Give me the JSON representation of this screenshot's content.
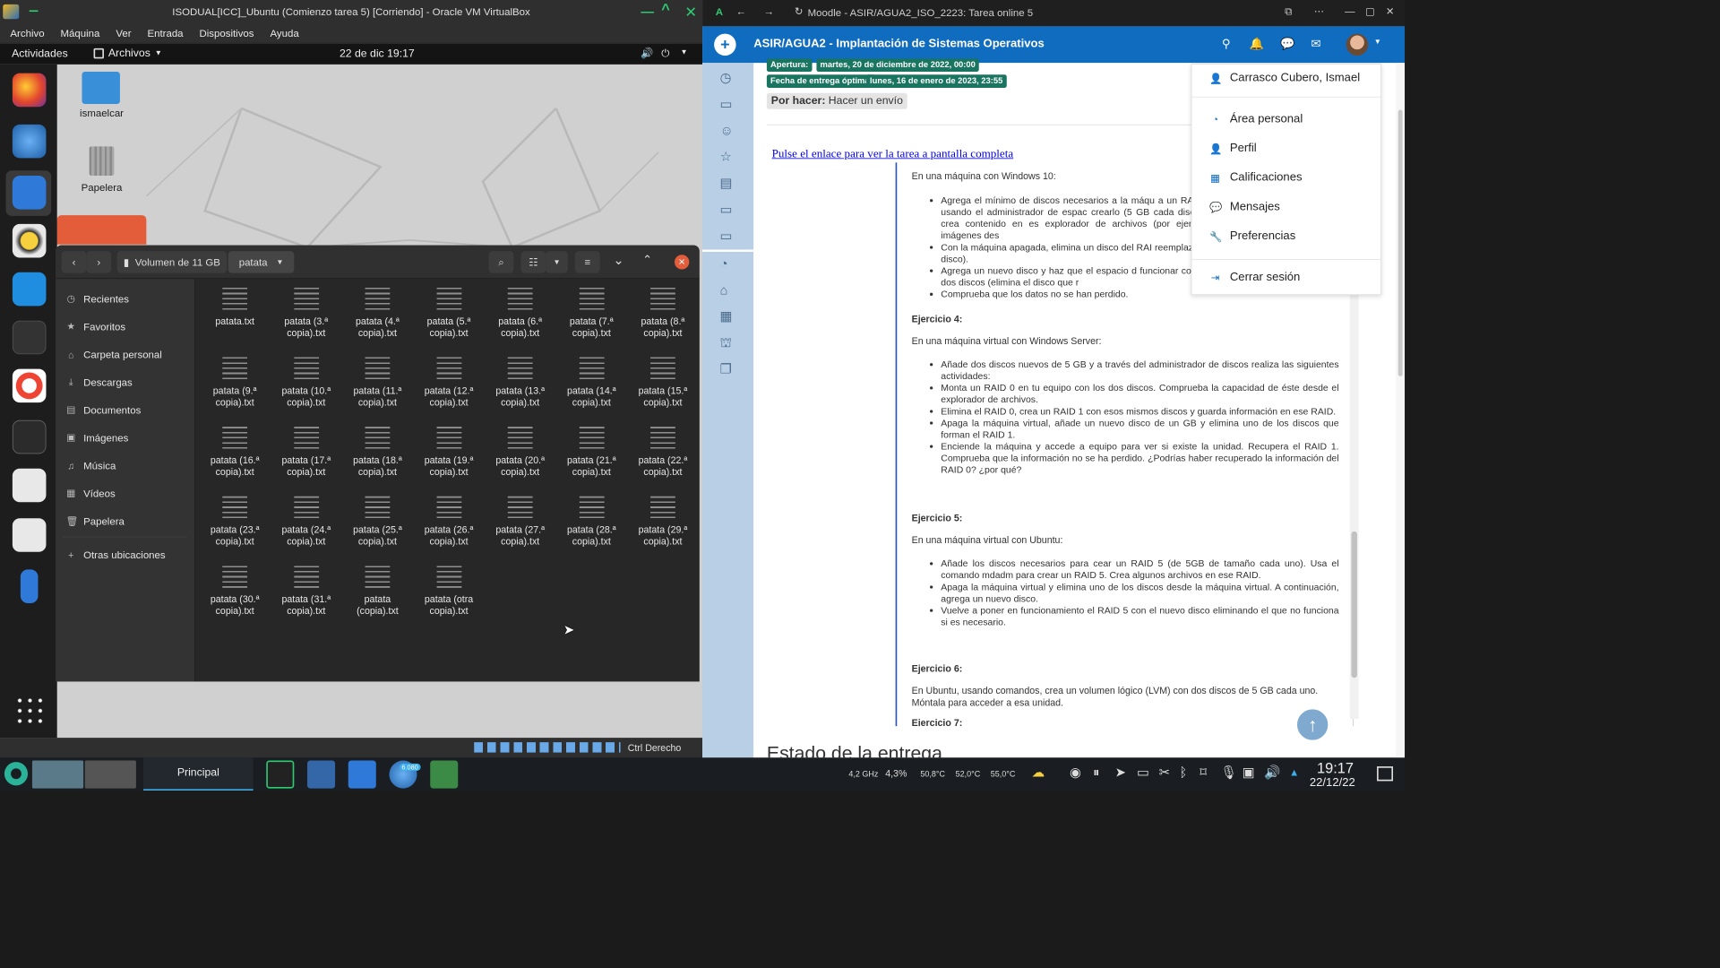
{
  "vbox": {
    "title": "ISODUAL[ICC]_Ubuntu (Comienzo tarea 5) [Corriendo] - Oracle VM VirtualBox",
    "menu": [
      "Archivo",
      "Máquina",
      "Ver",
      "Entrada",
      "Dispositivos",
      "Ayuda"
    ],
    "status_right": "Ctrl Derecho"
  },
  "gnome": {
    "activities": "Actividades",
    "app_menu": "Archivos",
    "clock": "22 de dic  19:17"
  },
  "desktop": {
    "home_icon_label": "ismaelcar",
    "trash_label": "Papelera"
  },
  "nautilus": {
    "path_volume": "Volumen de 11 GB",
    "path_folder": "patata",
    "sidebar": [
      {
        "icon": "clock-icon",
        "glyph": "◷",
        "label": "Recientes"
      },
      {
        "icon": "star-icon",
        "glyph": "★",
        "label": "Favoritos"
      },
      {
        "icon": "home-icon",
        "glyph": "⌂",
        "label": "Carpeta personal"
      },
      {
        "icon": "download-icon",
        "glyph": "⤓",
        "label": "Descargas"
      },
      {
        "icon": "document-icon",
        "glyph": "▤",
        "label": "Documentos"
      },
      {
        "icon": "image-icon",
        "glyph": "▣",
        "label": "Imágenes"
      },
      {
        "icon": "music-icon",
        "glyph": "♫",
        "label": "Música"
      },
      {
        "icon": "video-icon",
        "glyph": "▦",
        "label": "Vídeos"
      },
      {
        "icon": "trash-icon",
        "glyph": "🗑",
        "label": "Papelera"
      },
      {
        "icon": "plus-icon",
        "glyph": "+",
        "label": "Otras ubicaciones"
      }
    ],
    "files": [
      [
        "patata.txt",
        ""
      ],
      [
        "patata (3.ª",
        "copia).txt"
      ],
      [
        "patata (4.ª",
        "copia).txt"
      ],
      [
        "patata (5.ª",
        "copia).txt"
      ],
      [
        "patata (6.ª",
        "copia).txt"
      ],
      [
        "patata (7.ª",
        "copia).txt"
      ],
      [
        "patata (8.ª",
        "copia).txt"
      ],
      [
        "patata (9.ª",
        "copia).txt"
      ],
      [
        "patata (10.ª",
        "copia).txt"
      ],
      [
        "patata (11.ª",
        "copia).txt"
      ],
      [
        "patata (12.ª",
        "copia).txt"
      ],
      [
        "patata (13.ª",
        "copia).txt"
      ],
      [
        "patata (14.ª",
        "copia).txt"
      ],
      [
        "patata (15.ª",
        "copia).txt"
      ],
      [
        "patata (16.ª",
        "copia).txt"
      ],
      [
        "patata (17.ª",
        "copia).txt"
      ],
      [
        "patata (18.ª",
        "copia).txt"
      ],
      [
        "patata (19.ª",
        "copia).txt"
      ],
      [
        "patata (20.ª",
        "copia).txt"
      ],
      [
        "patata (21.ª",
        "copia).txt"
      ],
      [
        "patata (22.ª",
        "copia).txt"
      ],
      [
        "patata (23.ª",
        "copia).txt"
      ],
      [
        "patata (24.ª",
        "copia).txt"
      ],
      [
        "patata (25.ª",
        "copia).txt"
      ],
      [
        "patata (26.ª",
        "copia).txt"
      ],
      [
        "patata (27.ª",
        "copia).txt"
      ],
      [
        "patata (28.ª",
        "copia).txt"
      ],
      [
        "patata (29.ª",
        "copia).txt"
      ],
      [
        "patata (30.ª",
        "copia).txt"
      ],
      [
        "patata (31.ª",
        "copia).txt"
      ],
      [
        "patata",
        "(copia).txt"
      ],
      [
        "patata (otra",
        "copia).txt"
      ]
    ]
  },
  "browser": {
    "title": "Moodle - ASIR/AGUA2_ISO_2223: Tarea online 5",
    "course": "ASIR/AGUA2 - Implantación de Sistemas Operativos"
  },
  "moodle": {
    "chip_apertura_label": "Apertura:",
    "chip_apertura_value": "martes, 20 de diciembre de 2022, 00:00",
    "chip_entrega_label": "Fecha de entrega óptima:",
    "chip_entrega_value": "lunes, 16 de enero de 2023, 23:55",
    "por_hacer_bold": "Por hacer:",
    "por_hacer_text": "Hacer un envío",
    "fullscreen_link": "Pulse el enlace para ver la tarea a pantalla completa",
    "intro_windows10": "En una máquina con Windows 10:",
    "ej3_items": [
      "Agrega el mínimo de discos necesarios a la máqu a un RAID 1 usando el administrador de espac crearlo (5 GB cada disco) y crea contenido en es explorador de archivos (por ejemplo, imágenes des",
      "Con la máquina apagada, elimina un disco del RAI reemplazo de disco).",
      "Agrega un nuevo disco y haz que el espacio d funcionar con los dos discos (elimina el disco que r",
      "Comprueba que los datos no se han perdido."
    ],
    "ej4_title": "Ejercicio 4:",
    "ej4_intro": "En una máquina virtual con Windows Server:",
    "ej4_items": [
      "Añade dos discos nuevos de 5 GB y a través del administrador de discos realiza las siguientes actividades:",
      "Monta un RAID 0 en tu equipo con los dos discos. Comprueba la capacidad de éste desde el explorador de archivos.",
      "Elimina el RAID 0, crea un RAID 1 con esos mismos discos y guarda información en ese RAID.",
      "Apaga la máquina virtual, añade un nuevo disco de un GB y elimina uno de los discos que forman el RAID 1.",
      "Enciende la máquina y accede a equipo para ver si existe la unidad. Recupera el RAID 1. Comprueba que la información no se ha perdido. ¿Podrías haber recuperado la información del RAID 0? ¿por qué?"
    ],
    "ej5_title": "Ejercicio 5:",
    "ej5_intro": "En una máquina virtual con Ubuntu:",
    "ej5_items": [
      "Añade los discos necesarios para cear un RAID 5 (de 5GB de tamaño cada uno). Usa el comando mdadm para crear un RAID 5.  Crea algunos archivos en ese RAID.",
      "Apaga la máquina virtual y elimina uno de los discos desde la máquina virtual. A continuación, agrega un nuevo disco.",
      "Vuelve a poner en funcionamiento el RAID 5 con el nuevo disco eliminando el que no funciona si es necesario."
    ],
    "ej6_title": "Ejercicio 6:",
    "ej6_text": "En Ubuntu, usando comandos, crea un volumen lógico (LVM) con dos discos de 5 GB cada uno.  Móntala para acceder a esa unidad.",
    "ej7_title": "Ejercicio 7:",
    "estado": "Estado de la entrega",
    "user_menu": [
      {
        "icon": "user-icon",
        "glyph": "👤",
        "label": "Carrasco Cubero, Ismael"
      },
      {
        "icon": "dashboard-icon",
        "glyph": "◔",
        "label": "Área personal"
      },
      {
        "icon": "profile-icon",
        "glyph": "👤",
        "label": "Perfil"
      },
      {
        "icon": "grades-icon",
        "glyph": "▦",
        "label": "Calificaciones"
      },
      {
        "icon": "chat-icon",
        "glyph": "💬",
        "label": "Mensajes"
      },
      {
        "icon": "wrench-icon",
        "glyph": "🔧",
        "label": "Preferencias"
      },
      {
        "icon": "logout-icon",
        "glyph": "⇥",
        "label": "Cerrar sesión"
      }
    ]
  },
  "taskbar": {
    "workspace_label": "Principal",
    "badge": "6.080",
    "cpu_freq": "4,2 GHz",
    "cpu_load": "4,3%",
    "temp1": "50,8°C",
    "temp2": "52,0°C",
    "temp3": "55,0°C",
    "time": "19:17",
    "date": "22/12/22"
  },
  "colors": {
    "moodle_blue": "#0f6cbf",
    "chip_green": "#197560",
    "close_red": "#e35d3b"
  }
}
